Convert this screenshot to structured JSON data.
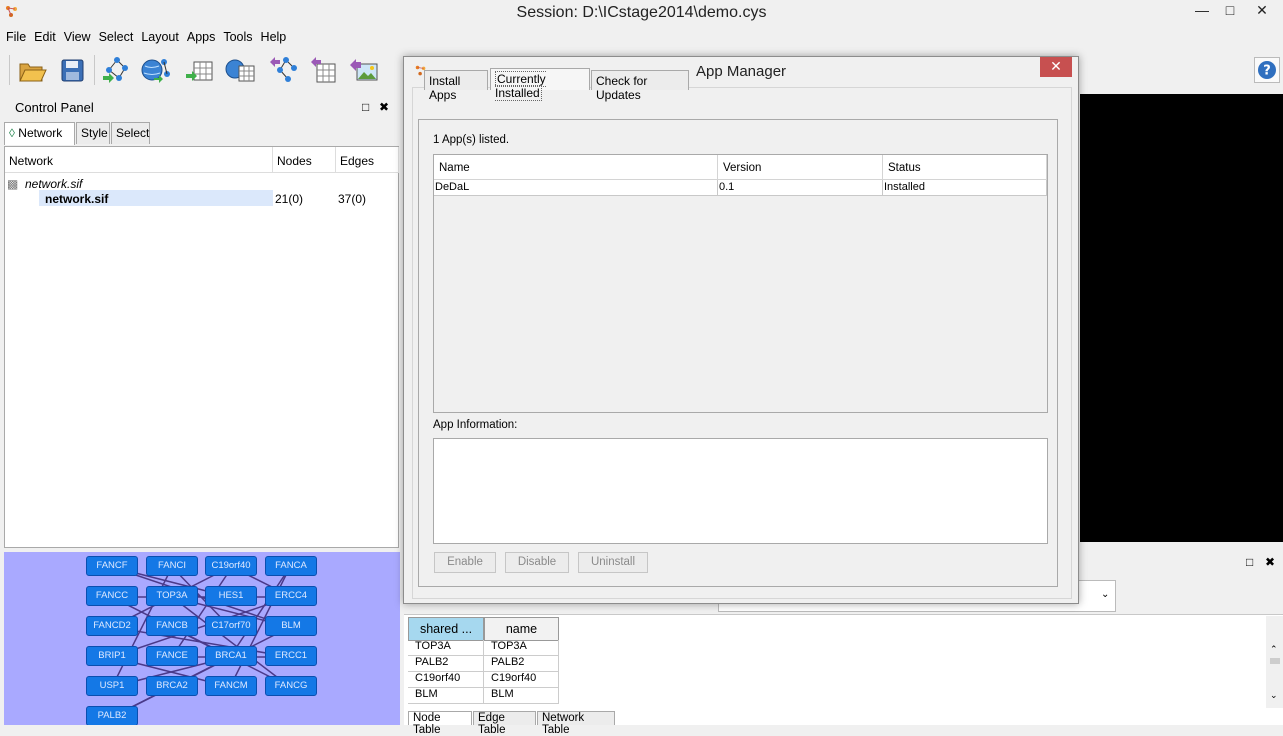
{
  "window": {
    "title": "Session: D:\\ICstage2014\\demo.cys",
    "minimize": "—",
    "maximize": "□",
    "close": "✕"
  },
  "menu": [
    "File",
    "Edit",
    "View",
    "Select",
    "Layout",
    "Apps",
    "Tools",
    "Help"
  ],
  "toolbar": {
    "icons": [
      "open-session-icon",
      "save-session-icon",
      "import-network-file-icon",
      "import-network-web-icon",
      "import-table-file-icon",
      "import-table-web-icon",
      "export-network-icon",
      "export-table-icon",
      "export-image-icon"
    ],
    "help": "?"
  },
  "control_panel": {
    "title": "Control Panel",
    "float_glyph": "□",
    "close_glyph": "✖",
    "tabs": [
      "Network",
      "Style",
      "Select"
    ],
    "columns": [
      "Network",
      "Nodes",
      "Edges"
    ],
    "collection": "network.sif",
    "network": {
      "name": "network.sif",
      "nodes": "21(0)",
      "edges": "37(0)"
    }
  },
  "thumbnail": {
    "nodes": [
      [
        "FANCF",
        "FANCI",
        "C19orf40",
        "FANCA"
      ],
      [
        "FANCC",
        "TOP3A",
        "HES1",
        "ERCC4"
      ],
      [
        "FANCD2",
        "FANCB",
        "C17orf70",
        "BLM"
      ],
      [
        "BRIP1",
        "FANCE",
        "BRCA1",
        "ERCC1"
      ],
      [
        "USP1",
        "BRCA2",
        "FANCM",
        "FANCG"
      ],
      [
        "PALB2"
      ]
    ]
  },
  "table_panel": {
    "float_glyph": "□",
    "close_glyph": "✖",
    "columns": [
      "shared ...",
      "name"
    ],
    "rows": [
      [
        "TOP3A",
        "TOP3A"
      ],
      [
        "PALB2",
        "PALB2"
      ],
      [
        "C19orf40",
        "C19orf40"
      ],
      [
        "BLM",
        "BLM"
      ]
    ],
    "tabs": [
      "Node Table",
      "Edge Table",
      "Network Table"
    ]
  },
  "dialog": {
    "title": "App Manager",
    "close_glyph": "✕",
    "tabs": [
      "Install Apps",
      "Currently Installed",
      "Check for Updates"
    ],
    "apps_count": "1 App(s) listed.",
    "columns": [
      "Name",
      "Version",
      "Status"
    ],
    "apps": [
      {
        "name": "DeDaL",
        "version": "0.1",
        "status": "Installed"
      }
    ],
    "info_label": "App Information:",
    "info_text": "",
    "buttons": [
      "Enable",
      "Disable",
      "Uninstall"
    ]
  }
}
